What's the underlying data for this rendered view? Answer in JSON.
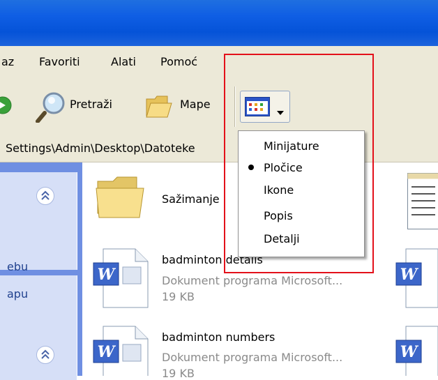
{
  "menu": {
    "items": [
      "az",
      "Favoriti",
      "Alati",
      "Pomoć"
    ]
  },
  "toolbar": {
    "search_label": "Pretraži",
    "folders_label": "Mape"
  },
  "address": {
    "path": "Settings\\Admin\\Desktop\\Datoteke"
  },
  "taskpane": {
    "link1": "ebu",
    "link2": "apu"
  },
  "files": [
    {
      "name": "Sažimanje"
    },
    {
      "name": "badminton details",
      "desc": "Dokument programa Microsoft...",
      "size": "19 KB"
    },
    {
      "name": "badminton numbers",
      "desc": "Dokument programa Microsoft...",
      "size": "19 KB"
    }
  ],
  "views_menu": {
    "items": [
      "Minijature",
      "Pločice",
      "Ikone",
      "Popis",
      "Detalji"
    ],
    "selected": "Pločice"
  },
  "colors": {
    "highlight": "#e3101a",
    "titlebar": "#0553d8"
  }
}
